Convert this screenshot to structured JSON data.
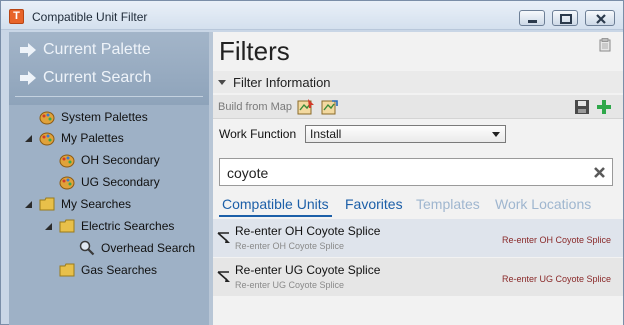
{
  "window": {
    "title": "Compatible Unit Filter",
    "app_icon_letter": "T"
  },
  "left_panel": {
    "nav": [
      {
        "label": "Current Palette"
      },
      {
        "label": "Current Search"
      }
    ],
    "tree": [
      {
        "label": "System Palettes",
        "icon": "palette-icon",
        "level": 0,
        "expander": "none"
      },
      {
        "label": "My Palettes",
        "icon": "palette-icon",
        "level": 0,
        "expander": "expanded"
      },
      {
        "label": "OH Secondary",
        "icon": "palette-icon",
        "level": 1,
        "expander": "none"
      },
      {
        "label": "UG Secondary",
        "icon": "palette-icon",
        "level": 1,
        "expander": "none"
      },
      {
        "label": "My Searches",
        "icon": "folder-icon",
        "level": 0,
        "expander": "expanded"
      },
      {
        "label": "Electric Searches",
        "icon": "folder-icon",
        "level": 1,
        "expander": "expanded"
      },
      {
        "label": "Overhead Search",
        "icon": "magnifier-icon",
        "level": 2,
        "expander": "none"
      },
      {
        "label": "Gas Searches",
        "icon": "folder-icon",
        "level": 1,
        "expander": "none"
      }
    ]
  },
  "right_panel": {
    "title": "Filters",
    "section_header": "Filter Information",
    "build_from_map_label": "Build from Map",
    "work_function_label": "Work Function",
    "work_function_value": "Install",
    "search_value": "coyote",
    "tabs": [
      {
        "label": "Compatible Units",
        "state": "active"
      },
      {
        "label": "Favorites",
        "state": "enabled"
      },
      {
        "label": "Templates",
        "state": "disabled"
      },
      {
        "label": "Work Locations",
        "state": "disabled"
      }
    ],
    "results": [
      {
        "title": "Re-enter OH Coyote Splice",
        "subtitle": "Re-enter OH Coyote Splice",
        "right_label": "Re-enter OH Coyote Splice",
        "selected": true
      },
      {
        "title": "Re-enter UG Coyote Splice",
        "subtitle": "Re-enter UG Coyote Splice",
        "right_label": "Re-enter UG Coyote Splice",
        "selected": false
      }
    ]
  },
  "colors": {
    "accent": "#1c5fa8",
    "disabled_tab": "#9fb6cf",
    "result_right_label": "#8a2a2a",
    "left_panel_bg": "#9eb1c6"
  }
}
